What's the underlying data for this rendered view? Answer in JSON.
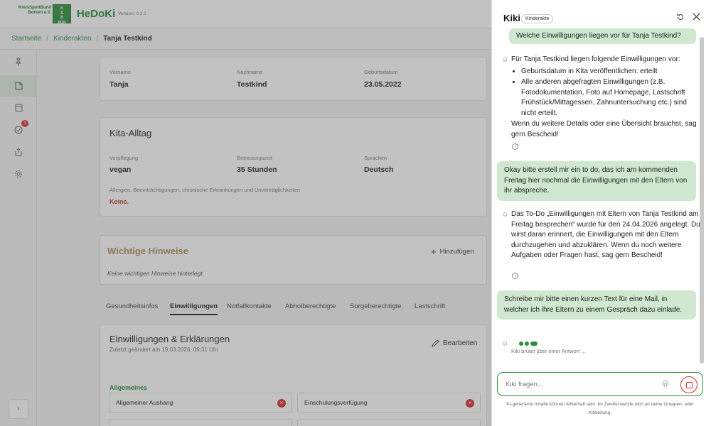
{
  "header": {
    "logo_line1": "KreisSportBund",
    "logo_line2": "Borken e.V.",
    "logo_box_l1": "K",
    "logo_box_l2": "S",
    "logo_box_l3": "B",
    "logo_box_l4": "BOR",
    "title": "HeDoKi",
    "version": "Version: 0.3.1"
  },
  "breadcrumb": {
    "items": [
      "Startseite",
      "Kinderakten"
    ],
    "current": "Tanja Testkind"
  },
  "sidebar": {
    "notification_count": "3"
  },
  "child": {
    "fields": [
      {
        "label": "Vorname",
        "value": "Tanja"
      },
      {
        "label": "Nachname",
        "value": "Testkind"
      },
      {
        "label": "Geburtsdatum",
        "value": "23.05.2022"
      }
    ]
  },
  "kita": {
    "title": "Kita-Alltag",
    "fields": [
      {
        "label": "Verpflegung",
        "value": "vegan"
      },
      {
        "label": "Betreuungszeit",
        "value": "35 Stunden"
      },
      {
        "label": "Sprachen",
        "value": "Deutsch"
      }
    ],
    "allergy_label": "Allergien, Beeinträchtigungen, chronische Erkrankungen und Unverträglichkeiten",
    "allergy_value": "Keine."
  },
  "hints": {
    "title": "Wichtige Hinweise",
    "add_label": "Hinzufügen",
    "empty": "Keine wichtigen Hinweise hinterlegt."
  },
  "tabs": [
    {
      "label": "Gesundheitsinfos"
    },
    {
      "label": "Einwilligungen"
    },
    {
      "label": "Notfallkontakte"
    },
    {
      "label": "Abholberechtigte"
    },
    {
      "label": "Sorgeberechtigte"
    },
    {
      "label": "Lastschrift"
    }
  ],
  "consent": {
    "title": "Einwilligungen & Erklärungen",
    "updated": "Zuletzt geändert am 19.03.2026, 09:31 Uhr",
    "edit_label": "Bearbeiten",
    "section": "Allgemeines",
    "items": [
      "Allgemeiner Aushang",
      "Einschulungsverfügung"
    ]
  },
  "chat": {
    "title": "Kiki",
    "badge": "Kinderakte",
    "msg1_user": "Welche Einwilligungen liegen vor für Tanja Testkind?",
    "msg2_bot_intro": "Für Tanja Testkind liegen folgende Einwilligungen vor:",
    "msg2_bot_list": [
      "Geburtsdatum in Kita veröffentlichen: erteilt",
      "Alle anderen abgefragten Einwilligungen (z.B. Fotodokumentation, Foto auf Homepage, Lastschrift Frühstück/Mittagessen, Zahnuntersuchung etc.) sind nicht erteilt."
    ],
    "msg2_bot_outro": "Wenn du weitere Details oder eine Übersicht brauchst, sag gern Bescheid!",
    "msg3_user": "Okay bitte erstell mir ein to do, das ich am kommenden Freitag hier nochmal die Einwilligungen mit den Eltern von ihr abspreche.",
    "msg4_bot": "Das To-Do „Einwilligungen mit Eltern von Tanja Testkind am Freitag besprechen“ wurde für den 24.04.2026 angelegt. Du wirst daran erinnert, die Einwilligungen mit den Eltern durchzugehen und abzuklären. Wenn du noch weitere Aufgaben oder Fragen hast, sag gern Bescheid!",
    "msg5_user": "Schreibe mir bitte einen kurzen Text für eine Mail, in welcher ich ihre Eltern zu einem Gespräch dazu einlade.",
    "thinking": "Kiki brütet über einer Antwort ...",
    "input_placeholder": "Kiki fragen...",
    "disclaimer": "KI-generierte Inhalte können fehlerhaft sein. Im Zweifel wende dich an deine Gruppen- oder Kitaleitung."
  }
}
